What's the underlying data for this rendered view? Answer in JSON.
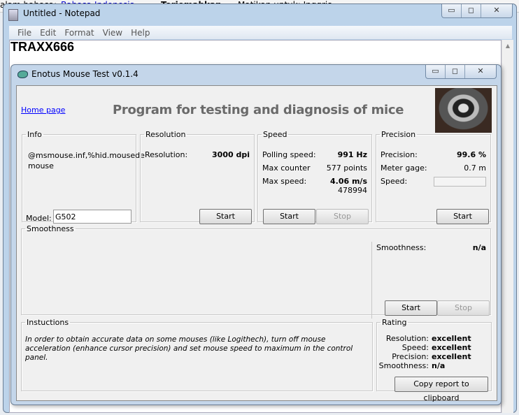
{
  "background": {
    "texts": [
      "alam bahasa:",
      "Bahasa Indonesia",
      "Terjemahkan",
      "Matikan untuk: Inggris"
    ]
  },
  "notepad": {
    "title": "Untitled - Notepad",
    "menu": [
      "File",
      "Edit",
      "Format",
      "View",
      "Help"
    ],
    "content": "TRAXX666"
  },
  "window": {
    "title": "Enotus Mouse Test v0.1.4",
    "minimize": "▭",
    "maximize": "◻",
    "close": "✕"
  },
  "header": {
    "home_link": "Home page",
    "heading": "Program for testing and diagnosis of mice"
  },
  "info": {
    "legend": "Info",
    "device": "@msmouse.inf,%hid.mousedemouse",
    "device_line1": "@msmouse.inf,%hid.mousede",
    "device_line2": "mouse",
    "model_label": "Model:",
    "model_value": "G502"
  },
  "resolution": {
    "legend": "Resolution",
    "label": "Resolution:",
    "value": "3000 dpi",
    "start": "Start"
  },
  "speed": {
    "legend": "Speed",
    "polling_label": "Polling speed:",
    "polling_value": "991 Hz",
    "counter_label": "Max counter",
    "counter_value": "577 points",
    "max_label": "Max  speed:",
    "max_value": "4.06 m/s",
    "max_raw": "478994",
    "start": "Start",
    "stop": "Stop"
  },
  "precision": {
    "legend": "Precision",
    "precision_label": "Precision:",
    "precision_value": "99.6 %",
    "meter_label": "Meter gage:",
    "meter_value": "0.7 m",
    "speed_label": "Speed:",
    "speed_value": "",
    "start": "Start"
  },
  "smoothness": {
    "legend": "Smoothness",
    "label": "Smoothness:",
    "value": "n/a",
    "start": "Start",
    "stop": "Stop"
  },
  "instructions": {
    "legend": "Instuctions",
    "text": "In order to obtain accurate data on some mouses (like Logithech), turn off mouse acceleration (enhance cursor precision) and set mouse speed to maximum in the control panel."
  },
  "rating": {
    "legend": "Rating",
    "items": [
      {
        "label": "Resolution:",
        "value": "excellent"
      },
      {
        "label": "Speed:",
        "value": "excellent"
      },
      {
        "label": "Precision:",
        "value": "excellent"
      },
      {
        "label": "Smoothness:",
        "value": "n/a"
      }
    ],
    "copy_button": "Copy report to clipboard"
  },
  "colors": {
    "heading": "#6a6a6a",
    "link": "#0000ff",
    "window_frame": "#c4d6ea"
  }
}
